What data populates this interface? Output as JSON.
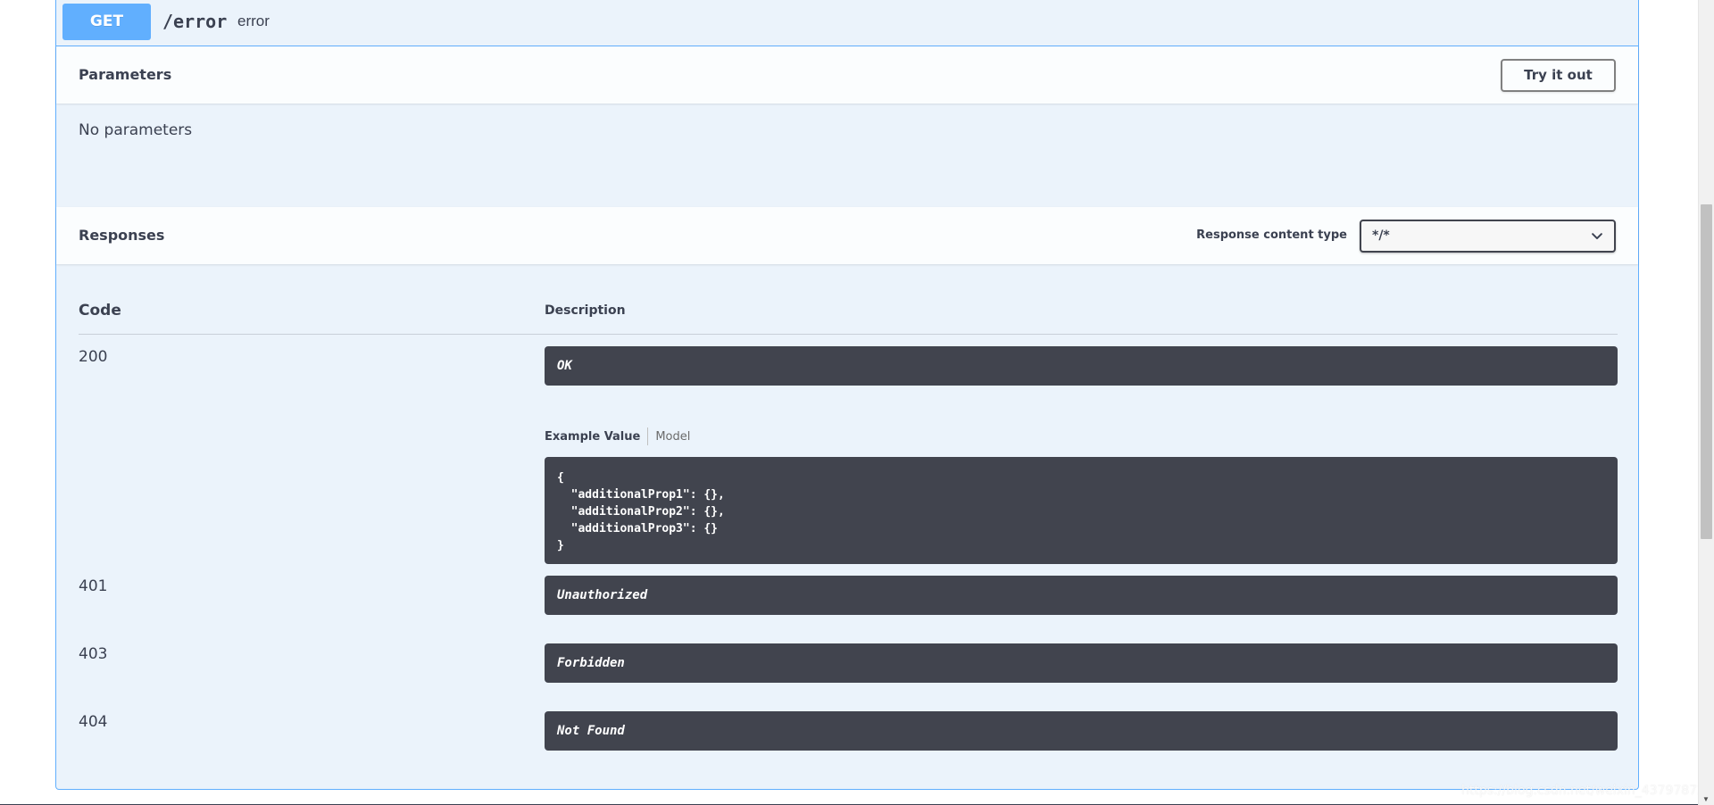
{
  "operation": {
    "method": "GET",
    "path": "/error",
    "summary": "error"
  },
  "parameters": {
    "title": "Parameters",
    "try_button": "Try it out",
    "empty_text": "No parameters"
  },
  "responses": {
    "title": "Responses",
    "content_type_label": "Response content type",
    "content_type_value": "*/*",
    "headers": {
      "code": "Code",
      "description": "Description"
    },
    "rows": [
      {
        "code": "200",
        "description": "OK"
      },
      {
        "code": "401",
        "description": "Unauthorized"
      },
      {
        "code": "403",
        "description": "Forbidden"
      },
      {
        "code": "404",
        "description": "Not Found"
      }
    ],
    "example_tabs": {
      "example_value": "Example Value",
      "model": "Model"
    },
    "example_body": "{\n  \"additionalProp1\": {},\n  \"additionalProp2\": {},\n  \"additionalProp3\": {}\n}"
  },
  "watermark": "https://blog.csdn.net/weixin_43797872",
  "colors": {
    "get_accent": "#61affe",
    "opblock_bg": "#ebf3fb",
    "code_bg": "#41444e",
    "text": "#3b4151"
  }
}
